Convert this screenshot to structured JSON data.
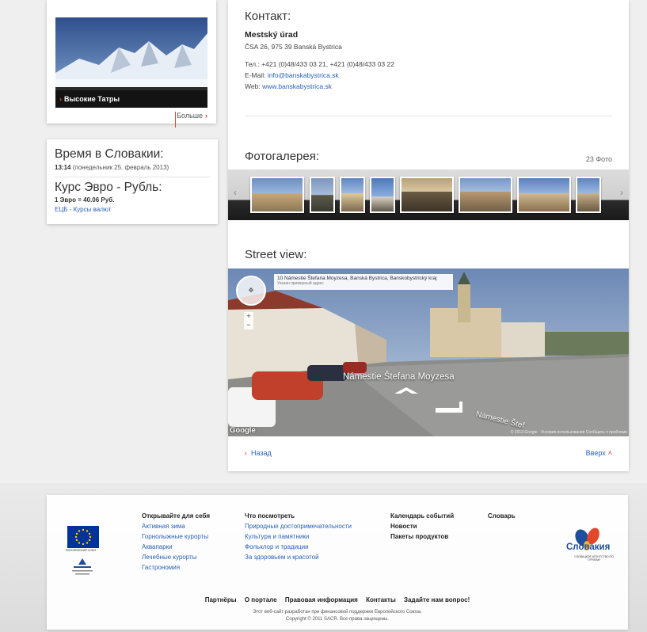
{
  "sidebar": {
    "region_card": {
      "caption": "Высокие Татры",
      "more_label": "Больше"
    },
    "info_card": {
      "time_title": "Время в Словакии:",
      "time_value": "13:14",
      "time_date": "(понедельник 25. февраль 2013)",
      "rate_title": "Курс Эвро - Рубль:",
      "rate_value": "1 Эвро = 40.06 Руб.",
      "rate_link": "ЕЦБ - Курсы валют"
    }
  },
  "contact": {
    "heading": "Контакт:",
    "name": "Mestský úrad",
    "address": "ČSA 26, 975 39 Banská Bystrica",
    "phone": "Тел.: +421 (0)48/433 03 21, +421 (0)48/433 03 22",
    "email_label": "E-Mail:",
    "email": "info@banskabystrica.sk",
    "web_label": "Web:",
    "web": "www.banskabystrica.sk"
  },
  "gallery": {
    "heading": "Фотогалерея:",
    "count": "23 Фото",
    "prev_icon": "‹",
    "next_icon": "›"
  },
  "street_view": {
    "heading": "Street view:",
    "address": "10 Námestie Štefana Moyzesa, Banská Bystrica, Banskobystrický kraj",
    "address_hint": "Указан примерный адрес",
    "street_label": "Námestie Štefana Moyzesa",
    "street_label2": "Námestie Štef",
    "google_label": "Google",
    "copyright": "© 2013 Google · Условия использования  Сообщить о проблеме"
  },
  "nav": {
    "back_label": "Назад",
    "top_label": "Вверх"
  },
  "footer": {
    "eu_caption": "ЕВРОПЕЙСКИЙ СОЮЗ",
    "columns": [
      {
        "head": "Открывайте для себя",
        "items": [
          "Активная зима",
          "Горнолыжные курорты",
          "Аквапарки",
          "Лечебные курорты",
          "Гастрономия"
        ]
      },
      {
        "head": "Что посмотреть",
        "items": [
          "Природные достопримечательности",
          "Культура и памятники",
          "Фольклор и традиции",
          "За здоровьем и красотой"
        ]
      },
      {
        "head": "Календарь событий",
        "items": [
          "Новости",
          "Пакеты продуктов"
        ]
      },
      {
        "head": "Словарь",
        "items": []
      }
    ],
    "logo_text": "Словакия",
    "logo_subtext": "СЛОВАЦКОЕ АГЕНТСТВО ПО ТУРИЗМУ",
    "bottom_links": [
      "Партнёры",
      "О портале",
      "Правовая информация",
      "Контакты",
      "Задайте нам вопрос!"
    ],
    "credit_line1": "Этот веб-сайт разработан при финансовой поддержке Европейского Союза.",
    "credit_line2": "Copyright © 2011 SACR. Все права защищены."
  },
  "colors": {
    "link": "#2a62b8",
    "accent_red": "#d32b25",
    "eu_blue": "#003399",
    "slovakia_blue": "#1d4f9c"
  }
}
